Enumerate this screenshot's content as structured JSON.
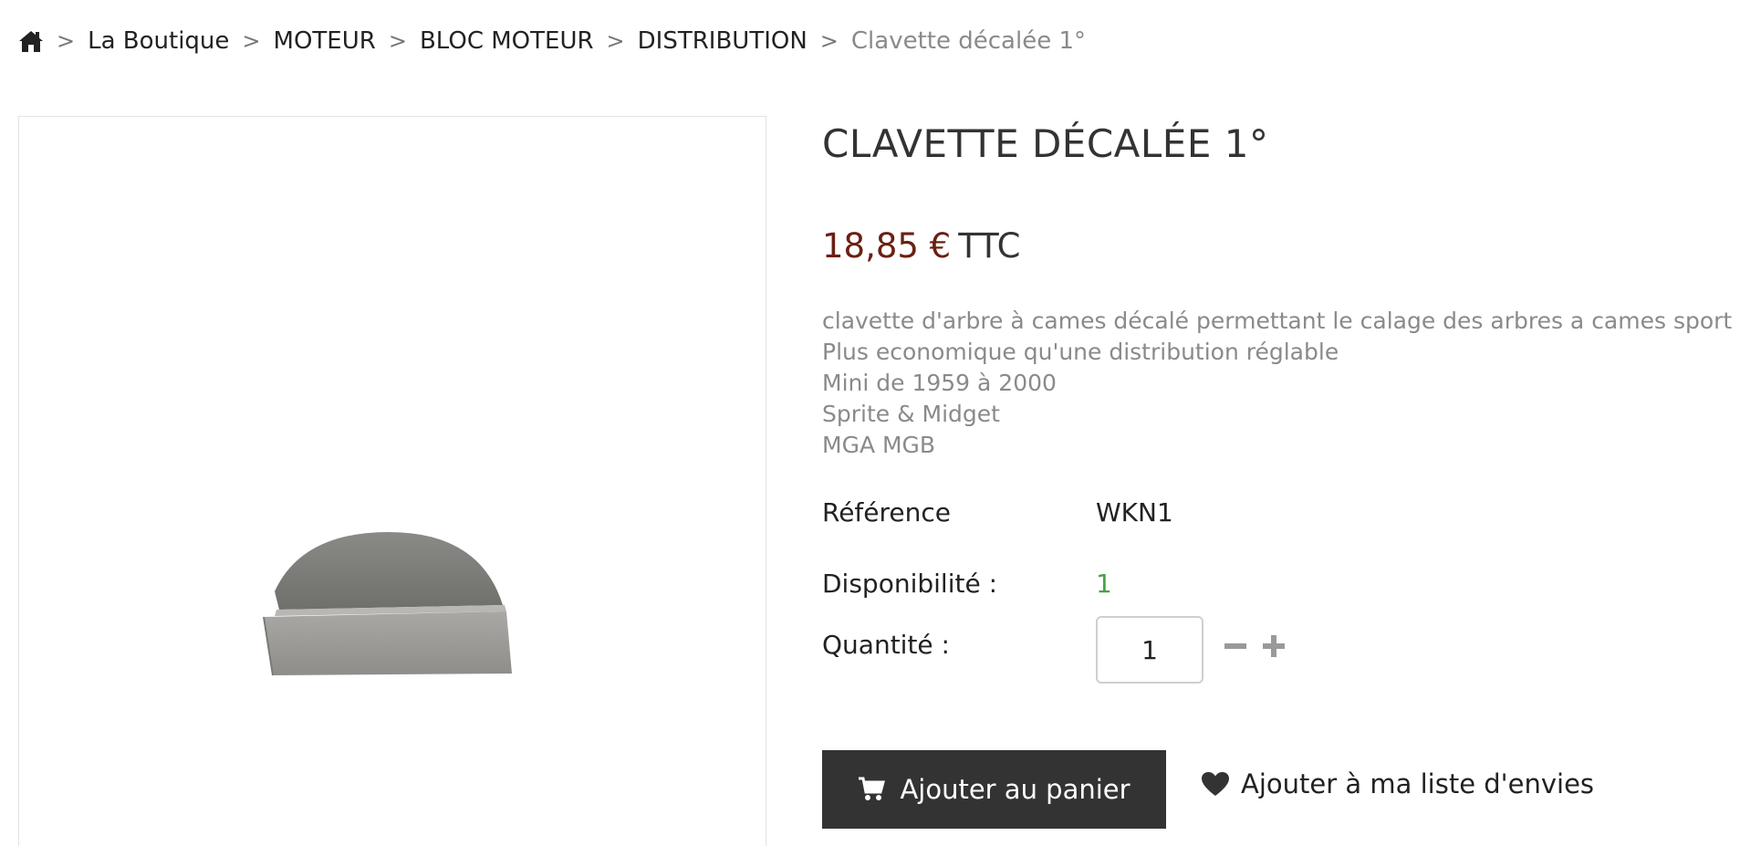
{
  "breadcrumb": {
    "home_icon": "home-icon",
    "items": [
      "La Boutique",
      "MOTEUR",
      "BLOC MOTEUR",
      "DISTRIBUTION"
    ],
    "current": "Clavette décalée 1°",
    "separator": ">"
  },
  "product": {
    "title": "CLAVETTE DÉCALÉE 1°",
    "price": "18,85 €",
    "tax_label": "TTC",
    "description": [
      "clavette d'arbre à cames décalé permettant le calage des arbres a cames sport",
      "Plus economique qu'une distribution réglable",
      "Mini de 1959 à 2000",
      "Sprite & Midget",
      "MGA MGB"
    ],
    "reference_label": "Référence",
    "reference_value": "WKN1",
    "availability_label": "Disponibilité :",
    "availability_value": "1",
    "quantity_label": "Quantité :",
    "quantity_value": "1"
  },
  "actions": {
    "add_to_cart": "Ajouter au panier",
    "add_to_wishlist": "Ajouter à ma liste d'envies"
  },
  "colors": {
    "price": "#6b1f12",
    "availability": "#4aa04a",
    "cart_button": "#333333",
    "muted_text": "#8a8a8a"
  },
  "icons": {
    "cart": "cart-icon",
    "wishlist": "heart-icon",
    "minus": "minus-icon",
    "plus": "plus-icon"
  }
}
